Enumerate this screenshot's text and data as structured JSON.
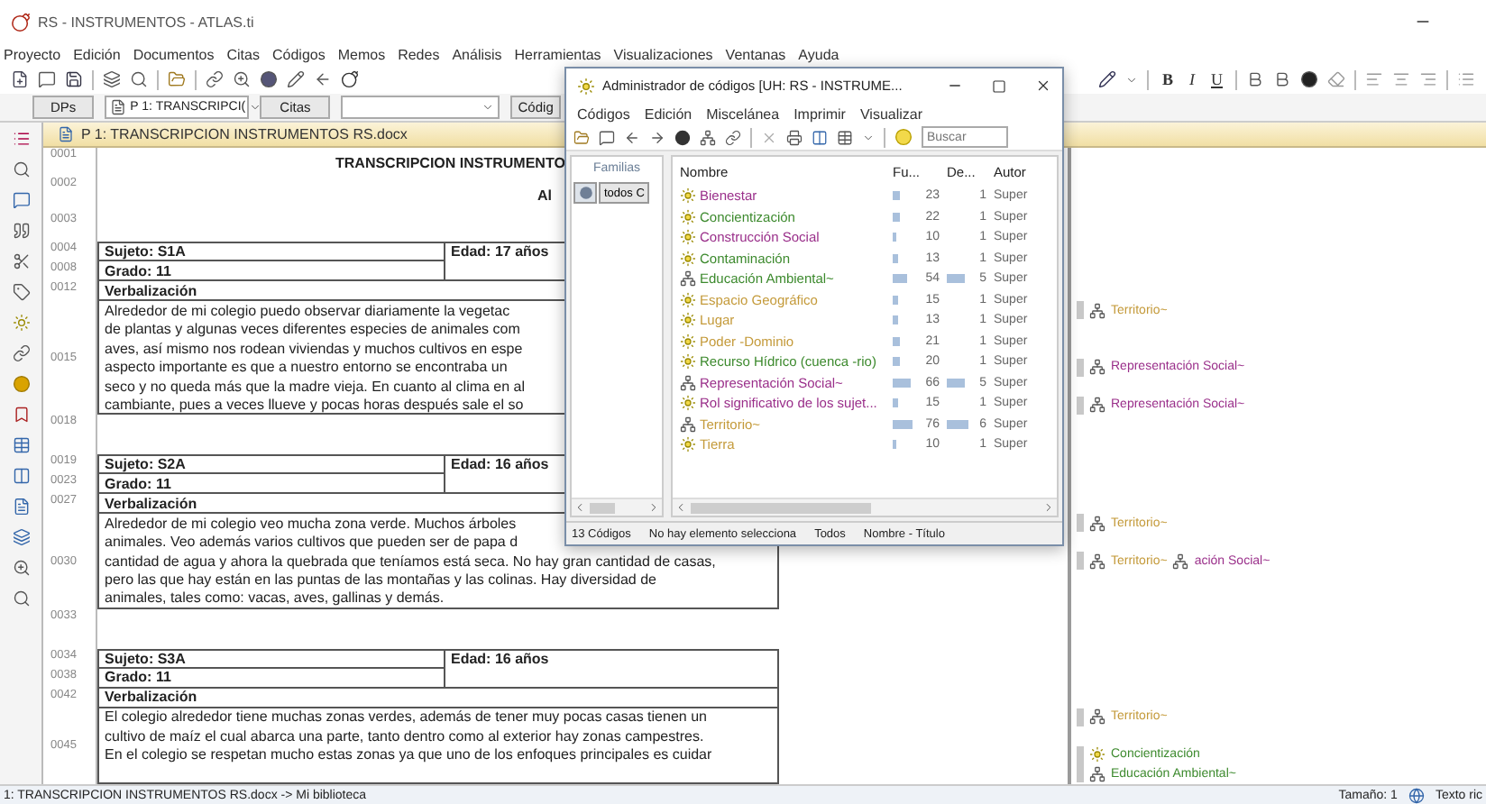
{
  "window": {
    "title": "RS - INSTRUMENTOS - ATLAS.ti"
  },
  "menu": [
    "Proyecto",
    "Edición",
    "Documentos",
    "Citas",
    "Códigos",
    "Memos",
    "Redes",
    "Análisis",
    "Herramientas",
    "Visualizaciones",
    "Ventanas",
    "Ayuda"
  ],
  "toolbar2": {
    "documents_button": "DPs",
    "document_select": "P 1: TRANSCRIPCI(",
    "quotes_button": "Citas",
    "codes_button": "Códig"
  },
  "format_buttons": [
    "B",
    "I",
    "U"
  ],
  "document": {
    "tab": "P 1: TRANSCRIPCION INSTRUMENTOS RS.docx",
    "blocks": [
      {
        "kind": "title",
        "num": "0001",
        "text": "TRANSCRIPCION INSTRUMENTO"
      },
      {
        "kind": "subtitle",
        "num": "0002",
        "text": "Al"
      },
      {
        "kind": "blank",
        "num": "0003"
      },
      {
        "kind": "record",
        "subject": {
          "num": "0004",
          "text": "Sujeto: S1A"
        },
        "age": "Edad: 17 años",
        "grade": {
          "num": "0008",
          "text": "Grado: 11"
        },
        "heading": {
          "num": "0012",
          "text": "Verbalización"
        },
        "text_num": "0015",
        "lines": [
          {
            "text": "Alrededor de mi colegio puedo observar diariamente la vegetac",
            "codes": [
              {
                "name": "Territorio~",
                "kind": "supercode",
                "color": "#c49a3a"
              }
            ]
          },
          {
            "text": "de plantas y algunas veces diferentes especies de animales com"
          },
          {
            "text": "aves, así mismo nos rodean viviendas y muchos cultivos en espe"
          },
          {
            "text": "aspecto importante es que a nuestro entorno se encontraba un",
            "codes": [
              {
                "name": "Representación Social~",
                "kind": "supercode",
                "color": "#9a2f8a"
              }
            ]
          },
          {
            "text": "seco y no queda más que la madre vieja. En cuanto al clima en al"
          },
          {
            "text": "cambiante, pues a veces llueve y pocas horas después sale el so",
            "codes": [
              {
                "name": "Representación Social~",
                "kind": "supercode",
                "color": "#9a2f8a"
              }
            ]
          }
        ]
      },
      {
        "kind": "blank",
        "num": "0018"
      },
      {
        "kind": "record",
        "subject": {
          "num": "0019",
          "text": "Sujeto: S2A"
        },
        "age": "Edad: 16 años",
        "grade": {
          "num": "0023",
          "text": "Grado: 11"
        },
        "heading": {
          "num": "0027",
          "text": "Verbalización"
        },
        "text_num": "0030",
        "lines": [
          {
            "text": "Alrededor de mi colegio veo mucha zona verde. Muchos árboles",
            "codes": [
              {
                "name": "Territorio~",
                "kind": "supercode",
                "color": "#c49a3a"
              }
            ]
          },
          {
            "text": "animales. Veo además varios cultivos que pueden ser de papa d"
          },
          {
            "text": "cantidad de agua y ahora la quebrada que teníamos está seca. No hay gran cantidad de casas,",
            "codes": [
              {
                "name": "Territorio~",
                "kind": "supercode",
                "color": "#c49a3a"
              },
              {
                "name": "ación Social~",
                "kind": "supercode",
                "color": "#9a2f8a"
              }
            ]
          },
          {
            "text": "pero las que hay están en las puntas de las montañas y las colinas. Hay diversidad de"
          },
          {
            "text": "animales, tales como: vacas, aves, gallinas y demás."
          }
        ]
      },
      {
        "kind": "blank",
        "num": "0033"
      },
      {
        "kind": "record",
        "subject": {
          "num": "0034",
          "text": "Sujeto: S3A"
        },
        "age": "Edad: 16 años",
        "grade": {
          "num": "0038",
          "text": "Grado: 11"
        },
        "heading": {
          "num": "0042",
          "text": "Verbalización"
        },
        "text_num": "0045",
        "lines": [
          {
            "text": "El colegio alrededor tiene muchas zonas verdes, además de tener muy pocas casas tienen un",
            "codes": [
              {
                "name": "Territorio~",
                "kind": "supercode",
                "color": "#c49a3a"
              }
            ]
          },
          {
            "text": "cultivo de maíz el cual abarca una parte, tanto dentro como al exterior hay zonas campestres."
          },
          {
            "text": "En el colegio se respetan mucho estas zonas ya que uno de los enfoques principales es cuidar",
            "codes": [
              {
                "name": "Concientización",
                "kind": "code",
                "color": "#3d8a2e"
              }
            ]
          },
          {
            "codes": [
              {
                "name": "Educación Ambiental~",
                "kind": "supercode",
                "color": "#3d8a2e"
              }
            ]
          }
        ]
      }
    ]
  },
  "status_bar": {
    "document": "1: TRANSCRIPCION INSTRUMENTOS RS.docx ->  Mi biblioteca",
    "size": "Tamaño: 1",
    "format": "Texto ric"
  },
  "code_manager": {
    "title": "Administrador de códigos [UH: RS - INSTRUME...",
    "menu": [
      "Códigos",
      "Edición",
      "Miscelánea",
      "Imprimir",
      "Visualizar"
    ],
    "search": {
      "placeholder": "Buscar"
    },
    "families": {
      "heading": "Familias",
      "item": "todos C"
    },
    "columns": [
      "Nombre",
      "Fu...",
      "De...",
      "Autor"
    ],
    "codes": [
      {
        "name": "Bienestar",
        "kind": "code",
        "color": "#9a2f8a",
        "grounded": "23",
        "density": "1",
        "author": "Super"
      },
      {
        "name": "Concientización",
        "kind": "code",
        "color": "#3d8a2e",
        "grounded": "22",
        "density": "1",
        "author": "Super"
      },
      {
        "name": "Construcción Social",
        "kind": "code",
        "color": "#9a2f8a",
        "grounded": "10",
        "density": "1",
        "author": "Super"
      },
      {
        "name": "Contaminación",
        "kind": "code",
        "color": "#3d8a2e",
        "grounded": "13",
        "density": "1",
        "author": "Super"
      },
      {
        "name": "Educación Ambiental~",
        "kind": "supercode",
        "color": "#3d8a2e",
        "grounded": "54",
        "density": "5",
        "author": "Super"
      },
      {
        "name": "Espacio Geográfico",
        "kind": "code",
        "color": "#c49a3a",
        "grounded": "15",
        "density": "1",
        "author": "Super"
      },
      {
        "name": "Lugar",
        "kind": "code",
        "color": "#c49a3a",
        "grounded": "13",
        "density": "1",
        "author": "Super"
      },
      {
        "name": "Poder -Dominio",
        "kind": "code",
        "color": "#c49a3a",
        "grounded": "21",
        "density": "1",
        "author": "Super"
      },
      {
        "name": "Recurso Hídrico (cuenca -rio)",
        "kind": "code",
        "color": "#3d8a2e",
        "grounded": "20",
        "density": "1",
        "author": "Super"
      },
      {
        "name": "Representación Social~",
        "kind": "supercode",
        "color": "#9a2f8a",
        "grounded": "66",
        "density": "5",
        "author": "Super"
      },
      {
        "name": "Rol significativo de los sujet...",
        "kind": "code",
        "color": "#9a2f8a",
        "grounded": "15",
        "density": "1",
        "author": "Super"
      },
      {
        "name": "Territorio~",
        "kind": "supercode",
        "color": "#c49a3a",
        "grounded": "76",
        "density": "6",
        "author": "Super"
      },
      {
        "name": "Tierra",
        "kind": "code",
        "color": "#c49a3a",
        "grounded": "10",
        "density": "1",
        "author": "Super"
      }
    ],
    "status": [
      "13 Códigos",
      "No hay elemento selecciona",
      "Todos",
      "Nombre - Título"
    ]
  }
}
